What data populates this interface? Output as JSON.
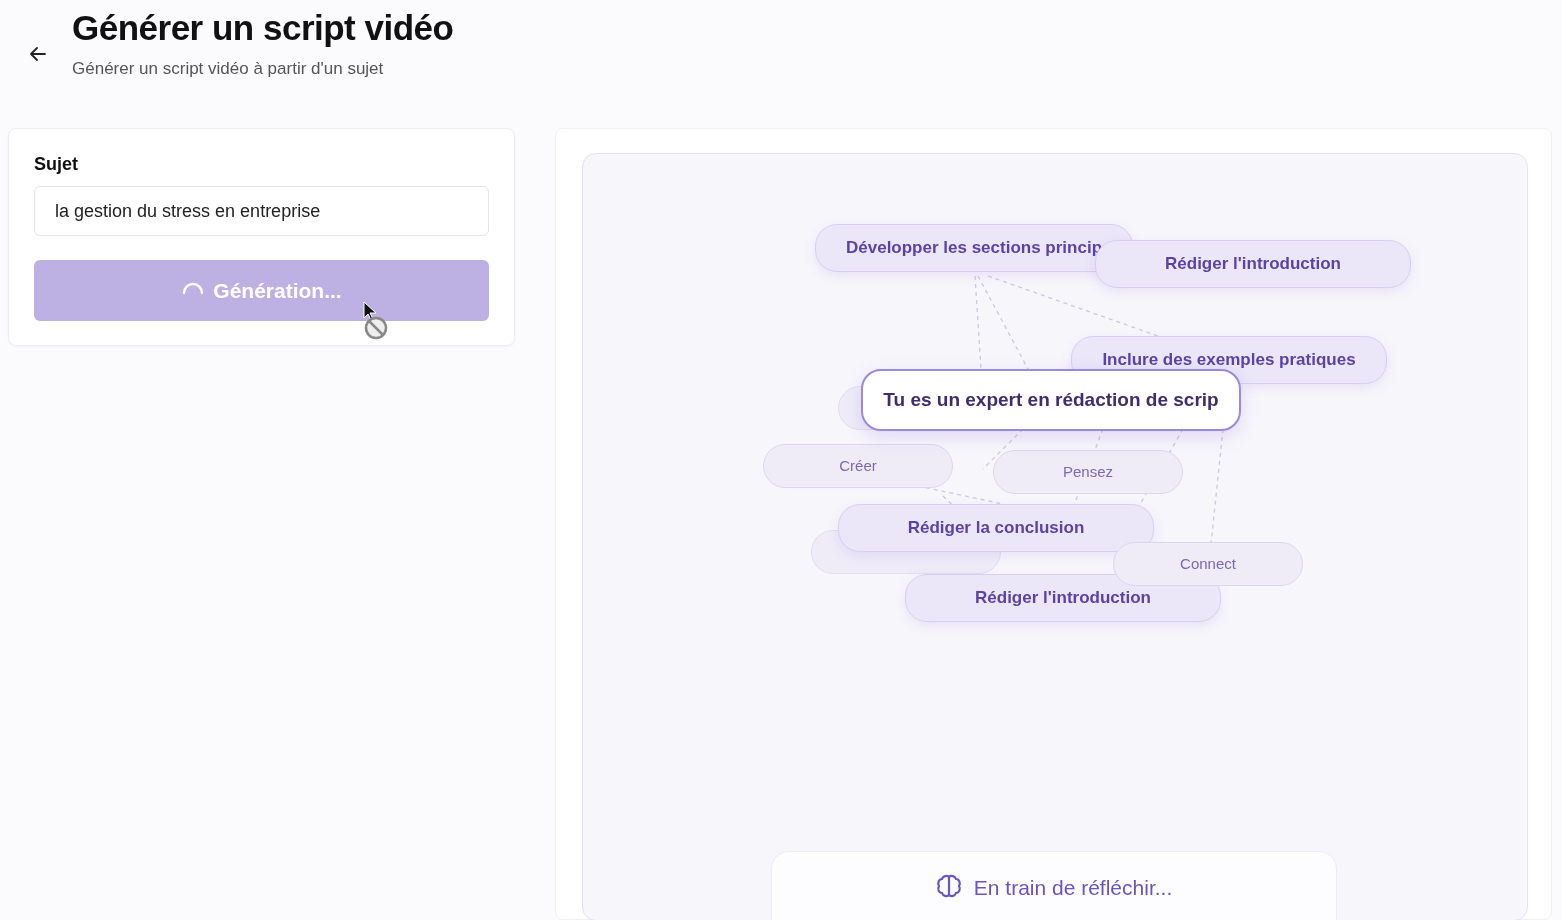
{
  "header": {
    "title": "Générer un script vidéo",
    "subtitle": "Générer un script vidéo à partir d'un sujet"
  },
  "form": {
    "label": "Sujet",
    "value": "la gestion du stress en entreprise",
    "button": {
      "label": "Génération...",
      "disabled": true,
      "loading": true
    }
  },
  "canvas": {
    "nodes": [
      {
        "kind": "step",
        "label": "Développer les sections princip"
      },
      {
        "kind": "step",
        "label": "Rédiger l'introduction"
      },
      {
        "kind": "step",
        "label": "Inclure des exemples pratiques"
      },
      {
        "kind": "blank"
      },
      {
        "kind": "main",
        "label": "Tu es un expert en rédaction de scrip"
      },
      {
        "kind": "keyword",
        "label": "Créer"
      },
      {
        "kind": "keyword",
        "label": "Pensez"
      },
      {
        "kind": "blank"
      },
      {
        "kind": "step",
        "label": "Rédiger la conclusion"
      },
      {
        "kind": "keyword",
        "label": "Connect"
      },
      {
        "kind": "step",
        "label": "Rédiger l'introduction"
      }
    ],
    "status": "En train de réfléchir..."
  }
}
